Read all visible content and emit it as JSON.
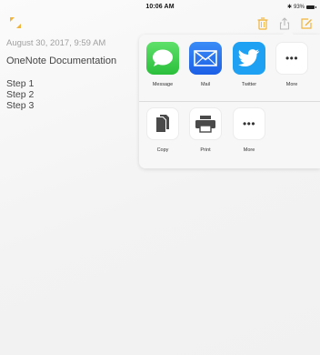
{
  "status_bar": {
    "time": "10:06 AM",
    "battery": "93%"
  },
  "colors": {
    "accent": "#f0b43c",
    "message_green": "#3fcc4e",
    "mail_blue": "#2a6ef3",
    "twitter_blue": "#1ea1f2"
  },
  "toolbar": {
    "left_icon": "expand-icon",
    "right_icons": [
      "trash-icon",
      "share-icon",
      "compose-icon"
    ]
  },
  "note": {
    "date": "August 30, 2017, 9:59 AM",
    "title": "OneNote Documentation",
    "steps": [
      "Step 1",
      "Step 2",
      "Step 3"
    ]
  },
  "share_sheet": {
    "apps": [
      {
        "label": "Message",
        "icon": "message-icon"
      },
      {
        "label": "Mail",
        "icon": "mail-icon"
      },
      {
        "label": "Twitter",
        "icon": "twitter-icon"
      },
      {
        "label": "More",
        "icon": "more-icon"
      }
    ],
    "actions": [
      {
        "label": "Copy",
        "icon": "copy-icon"
      },
      {
        "label": "Print",
        "icon": "print-icon"
      },
      {
        "label": "More",
        "icon": "more-icon"
      }
    ]
  }
}
